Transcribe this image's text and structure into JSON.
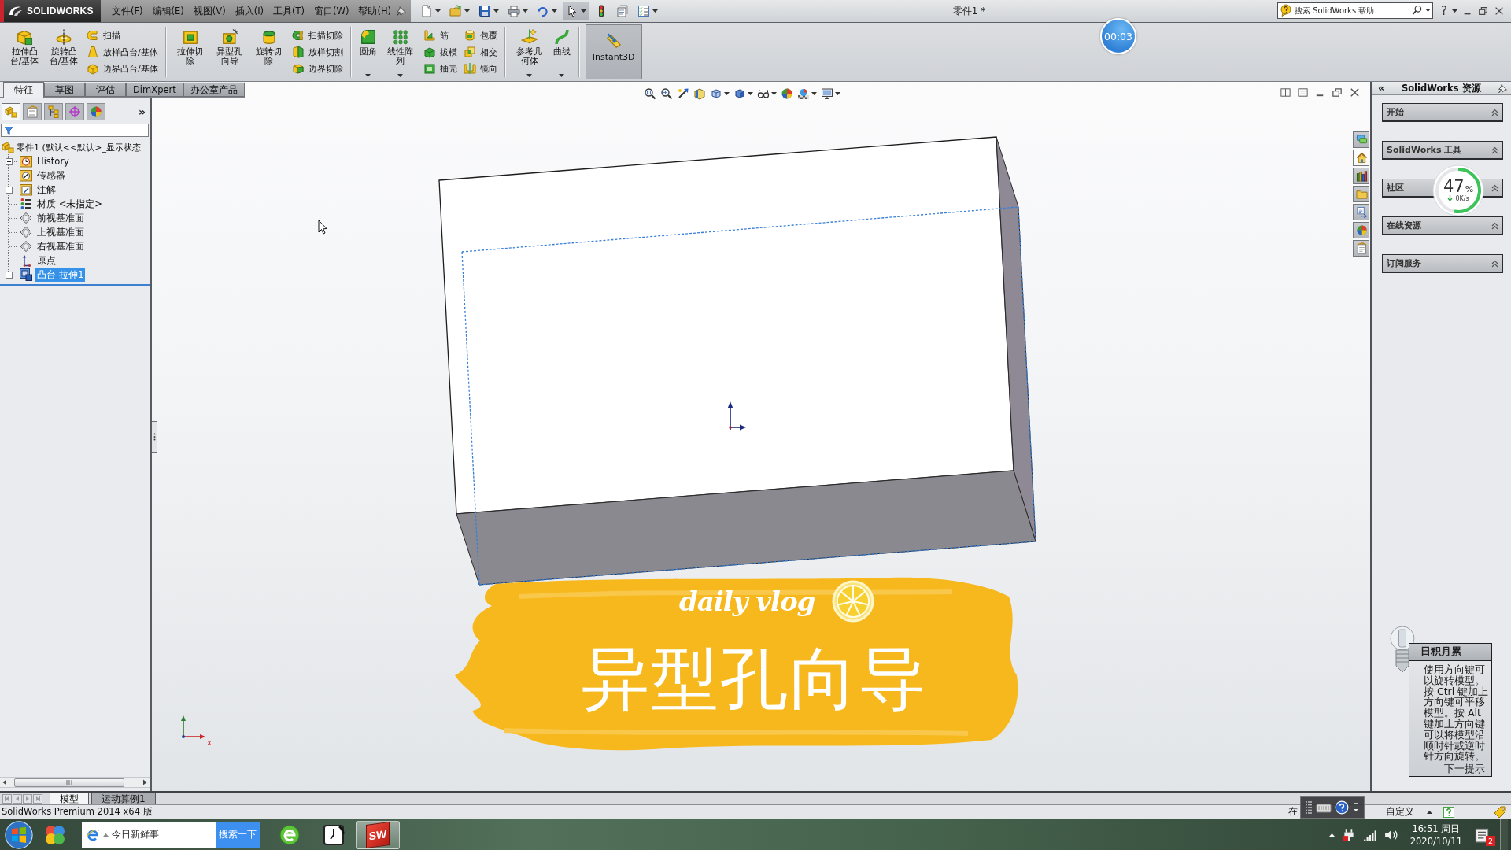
{
  "title_bar": {
    "logo": "SOLIDWORKS",
    "menus": [
      "文件(F)",
      "编辑(E)",
      "视图(V)",
      "插入(I)",
      "工具(T)",
      "窗口(W)",
      "帮助(H)"
    ],
    "quick_access": [
      {
        "dropdown": true,
        "pressed": false
      },
      {
        "dropdown": true,
        "pressed": false
      },
      {
        "dropdown": true,
        "pressed": false
      },
      {
        "dropdown": true,
        "pressed": false
      },
      {
        "dropdown": true,
        "pressed": false
      },
      {
        "dropdown": true,
        "pressed": true
      },
      {
        "dropdown": false,
        "pressed": false
      },
      {
        "dropdown": false,
        "pressed": false
      },
      {
        "dropdown": true,
        "pressed": false
      }
    ],
    "document_title": "零件1 *",
    "help_search": {
      "placeholder": "搜索 SolidWorks 帮助"
    },
    "help": "?"
  },
  "command_manager": {
    "groups": [
      [
        {
          "label": "拉伸凸台/基体",
          "kind": "large",
          "dropdown": false
        },
        {
          "label": "旋转凸台/基体",
          "kind": "large",
          "dropdown": false
        },
        {
          "label": "扫描",
          "kind": "small",
          "dropdown": false
        },
        {
          "label": "放样凸台/基体",
          "kind": "small",
          "dropdown": false
        },
        {
          "label": "边界凸台/基体",
          "kind": "small",
          "dropdown": false
        }
      ],
      [
        {
          "label": "拉伸切除",
          "kind": "large",
          "dropdown": false
        },
        {
          "label": "异型孔向导",
          "kind": "large",
          "dropdown": false
        },
        {
          "label": "旋转切除",
          "kind": "large",
          "dropdown": false
        },
        {
          "label": "扫描切除",
          "kind": "small",
          "dropdown": false
        },
        {
          "label": "放样切割",
          "kind": "small",
          "dropdown": false
        },
        {
          "label": "边界切除",
          "kind": "small",
          "dropdown": false
        }
      ],
      [
        {
          "label": "圆角",
          "kind": "large",
          "dropdown": true
        },
        {
          "label": "线性阵列",
          "kind": "large",
          "dropdown": true
        },
        {
          "label": "筋",
          "kind": "small",
          "dropdown": false
        },
        {
          "label": "拔模",
          "kind": "small",
          "dropdown": false
        },
        {
          "label": "抽壳",
          "kind": "small",
          "dropdown": false
        },
        {
          "label": "包覆",
          "kind": "small",
          "dropdown": false
        },
        {
          "label": "相交",
          "kind": "small",
          "dropdown": false
        },
        {
          "label": "镜向",
          "kind": "small",
          "dropdown": false
        }
      ],
      [
        {
          "label": "参考几何体",
          "kind": "large",
          "dropdown": true
        },
        {
          "label": "曲线",
          "kind": "large",
          "dropdown": true
        }
      ]
    ],
    "instant3d": {
      "label": "Instant3D",
      "on": true
    }
  },
  "tabs": [
    {
      "label": "特征",
      "selected": true
    },
    {
      "label": "草图",
      "selected": false
    },
    {
      "label": "评估",
      "selected": false
    },
    {
      "label": "DimXpert",
      "selected": false
    },
    {
      "label": "办公室产品",
      "selected": false
    }
  ],
  "feature_manager": {
    "tabs": [
      {
        "selected": true
      },
      {
        "selected": false
      },
      {
        "selected": false
      },
      {
        "selected": false
      },
      {
        "selected": false
      }
    ],
    "more": "»",
    "tree": {
      "label": "零件1 (默认<<默认>_显示状态",
      "children": [
        {
          "kind": "history",
          "label": "History",
          "expandable": true,
          "selected": false
        },
        {
          "kind": "sensor",
          "label": "传感器",
          "expandable": false,
          "selected": false
        },
        {
          "kind": "annotation",
          "label": "注解",
          "expandable": true,
          "selected": false
        },
        {
          "kind": "material",
          "label": "材质 <未指定>",
          "expandable": false,
          "selected": false
        },
        {
          "kind": "plane",
          "label": "前视基准面",
          "expandable": false,
          "selected": false
        },
        {
          "kind": "plane",
          "label": "上视基准面",
          "expandable": false,
          "selected": false
        },
        {
          "kind": "plane",
          "label": "右视基准面",
          "expandable": false,
          "selected": false
        },
        {
          "kind": "origin",
          "label": "原点",
          "expandable": false,
          "selected": false
        },
        {
          "kind": "feature",
          "label": "凸台-拉伸1",
          "expandable": true,
          "selected": true
        }
      ]
    }
  },
  "view_toolbar": [
    {
      "dropdown": false
    },
    {
      "dropdown": false
    },
    {
      "dropdown": false
    },
    {
      "dropdown": false
    },
    {
      "dropdown": true
    },
    {
      "dropdown": true
    },
    {
      "dropdown": true
    },
    {
      "dropdown": false
    },
    {
      "dropdown": true
    },
    {
      "dropdown": true
    }
  ],
  "triad_label": "x",
  "title_card": {
    "script": "daily vlog",
    "title": "异型孔向导"
  },
  "timer": "00:03",
  "usage_meter": {
    "value": "47",
    "unit": "%",
    "rate": "0K/s",
    "level": 0.53
  },
  "task_pane": {
    "collapse": "«",
    "title": "SolidWorks 资源",
    "tabs": [
      {
        "selected": false
      },
      {
        "selected": true
      },
      {
        "selected": false
      },
      {
        "selected": false
      },
      {
        "selected": false
      },
      {
        "selected": false
      },
      {
        "selected": false
      }
    ],
    "sections": [
      "开始",
      "SolidWorks 工具",
      "社区",
      "在线资源",
      "订阅服务"
    ],
    "tip": {
      "title": "日积月累",
      "text": "使用方向键可以旋转模型。按 Ctrl 键加上方向键可平移模型。按 Alt 键加上方向键可以将模型沿顺时针或逆时针方向旋转。",
      "next": "下一提示"
    }
  },
  "bottom_tabs": [
    {
      "label": "模型",
      "selected": true
    },
    {
      "label": "运动算例1",
      "selected": false
    }
  ],
  "status_bar": {
    "product": "SolidWorks Premium 2014 x64 版",
    "mode": "在",
    "units": "自定义"
  },
  "taskbar": {
    "apps": [
      {
        "active": false
      },
      {
        "active": false
      },
      {
        "active": false
      },
      {
        "active": true,
        "logo": "SW"
      }
    ],
    "search": {
      "value": "今日新鲜事",
      "button": "搜索一下"
    },
    "time": "16:51 周日",
    "date": "2020/10/11",
    "notifications": "2"
  }
}
